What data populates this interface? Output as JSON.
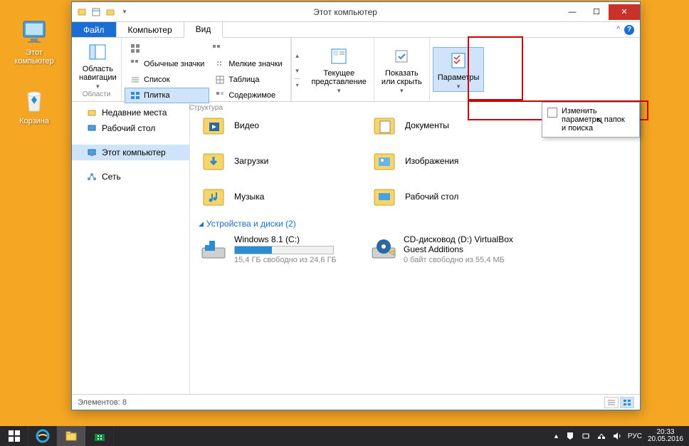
{
  "desktop": {
    "icons": [
      {
        "label": "Этот компьютер"
      },
      {
        "label": "Корзина"
      }
    ]
  },
  "window": {
    "title": "Этот компьютер",
    "tabs": {
      "file": "Файл",
      "computer": "Компьютер",
      "view": "Вид"
    },
    "ribbon": {
      "groups": {
        "areas": "Области",
        "structure": "Структура"
      },
      "nav_area": "Область\nнавигации",
      "layout": {
        "normal_icons": "Обычные значки",
        "small_icons": "Мелкие значки",
        "list": "Список",
        "table": "Таблица",
        "tiles": "Плитка",
        "content": "Содержимое"
      },
      "current_view": "Текущее\nпредставление",
      "show_hide": "Показать\nили скрыть",
      "options": "Параметры",
      "popup_item": "Изменить параметры папок и поиска"
    },
    "nav": {
      "recent": "Недавние места",
      "desktop": "Рабочий стол",
      "this_pc": "Этот компьютер",
      "network": "Сеть"
    },
    "content": {
      "folders": [
        "Видео",
        "Документы",
        "Загрузки",
        "Изображения",
        "Музыка",
        "Рабочий стол"
      ],
      "drives_header": "Устройства и диски (2)",
      "drives": [
        {
          "name": "Windows 8.1 (C:)",
          "info": "15,4 ГБ свободно из 24,6 ГБ",
          "fill": 38
        },
        {
          "name": "CD-дисковод (D:) VirtualBox Guest Additions",
          "info": "0 байт свободно из 55,4 МБ",
          "fill": 0
        }
      ]
    },
    "status": "Элементов: 8"
  },
  "taskbar": {
    "lang": "РУС",
    "time": "20:33",
    "date": "20.05.2016"
  }
}
